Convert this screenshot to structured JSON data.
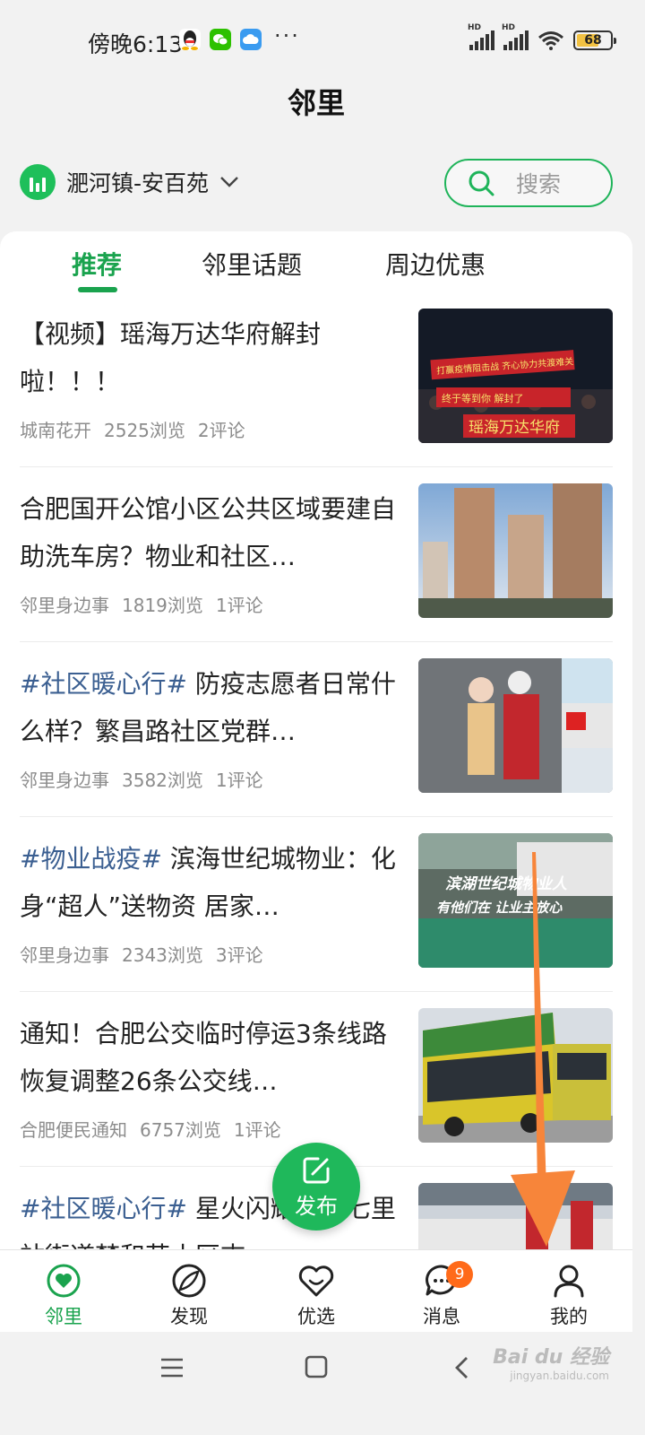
{
  "status_bar": {
    "time": "傍晚6:13",
    "more": "···",
    "hd1": "HD",
    "hd2": "HD",
    "battery": "68",
    "battery_level": 0.68
  },
  "header": {
    "title": "邻里",
    "location": "淝河镇-安百苑",
    "search_placeholder": "搜索"
  },
  "tabs": [
    "推荐",
    "邻里话题",
    "周边优惠"
  ],
  "articles": [
    {
      "tag": "",
      "title": "【视频】瑶海万达华府解封啦！！！",
      "source": "城南花开",
      "views": "2525浏览",
      "comments": "2评论"
    },
    {
      "tag": "",
      "title": "合肥国开公馆小区公共区域要建自助洗车房？物业和社区…",
      "source": "邻里身边事",
      "views": "1819浏览",
      "comments": "1评论"
    },
    {
      "tag": "#社区暖心行#",
      "title": " 防疫志愿者日常什么样？繁昌路社区党群…",
      "source": "邻里身边事",
      "views": "3582浏览",
      "comments": "1评论"
    },
    {
      "tag": "#物业战疫#",
      "title": " 滨海世纪城物业：化身“超人”送物资 居家…",
      "source": "邻里身边事",
      "views": "2343浏览",
      "comments": "3评论",
      "thumb_caption_1": "滨湖世纪城物业人",
      "thumb_caption_2": "有他们在 让业主放心"
    },
    {
      "tag": "",
      "title": "通知！合肥公交临时停运3条线路 恢复调整26条公交线…",
      "source": "合肥便民通知",
      "views": "6757浏览",
      "comments": "1评论"
    },
    {
      "tag": "#社区暖心行#",
      "title": " 星火闪耀合肥七里站街道梦和苑小区志…",
      "source": "",
      "views": "",
      "comments": ""
    }
  ],
  "thumb1_text": {
    "banner_a": "打赢疫情阻击战 齐心协力共渡难关",
    "banner_b": "终于等到你 解封了",
    "banner_c": "瑶海万达华府"
  },
  "fab": {
    "label": "发布"
  },
  "bottom_nav": [
    {
      "label": "邻里",
      "icon": "neighbor-heart-icon"
    },
    {
      "label": "发现",
      "icon": "compass-icon"
    },
    {
      "label": "优选",
      "icon": "smile-heart-icon"
    },
    {
      "label": "消息",
      "icon": "message-icon",
      "badge": "9"
    },
    {
      "label": "我的",
      "icon": "profile-icon"
    }
  ],
  "watermark": {
    "brand": "Bai du 经验",
    "url": "jingyan.baidu.com"
  },
  "colors": {
    "accent": "#1aa34e",
    "tag": "#3b5f91",
    "badge": "#ff6a19",
    "arrow": "#f7853a"
  }
}
